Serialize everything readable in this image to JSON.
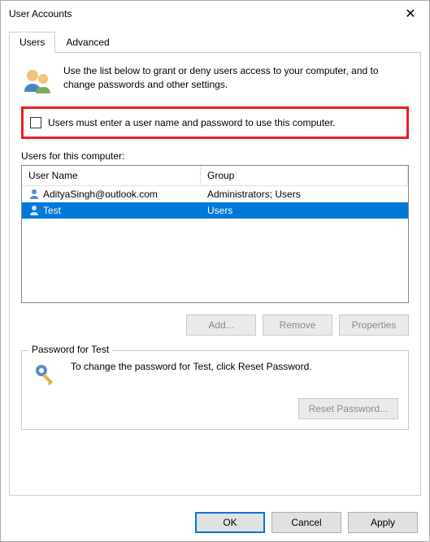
{
  "window": {
    "title": "User Accounts"
  },
  "tabs": {
    "users": "Users",
    "advanced": "Advanced"
  },
  "intro": "Use the list below to grant or deny users access to your computer, and to change passwords and other settings.",
  "checkbox": {
    "label": "Users must enter a user name and password to use this computer.",
    "checked": false
  },
  "list": {
    "label": "Users for this computer:",
    "columns": {
      "name": "User Name",
      "group": "Group"
    },
    "rows": [
      {
        "name": "AdityaSingh@outlook.com",
        "group": "Administrators; Users",
        "selected": false
      },
      {
        "name": "Test",
        "group": "Users",
        "selected": true
      }
    ]
  },
  "buttons": {
    "add": "Add...",
    "remove": "Remove",
    "properties": "Properties"
  },
  "password": {
    "legend": "Password for Test",
    "text": "To change the password for Test, click Reset Password.",
    "reset": "Reset Password..."
  },
  "dialog": {
    "ok": "OK",
    "cancel": "Cancel",
    "apply": "Apply"
  }
}
